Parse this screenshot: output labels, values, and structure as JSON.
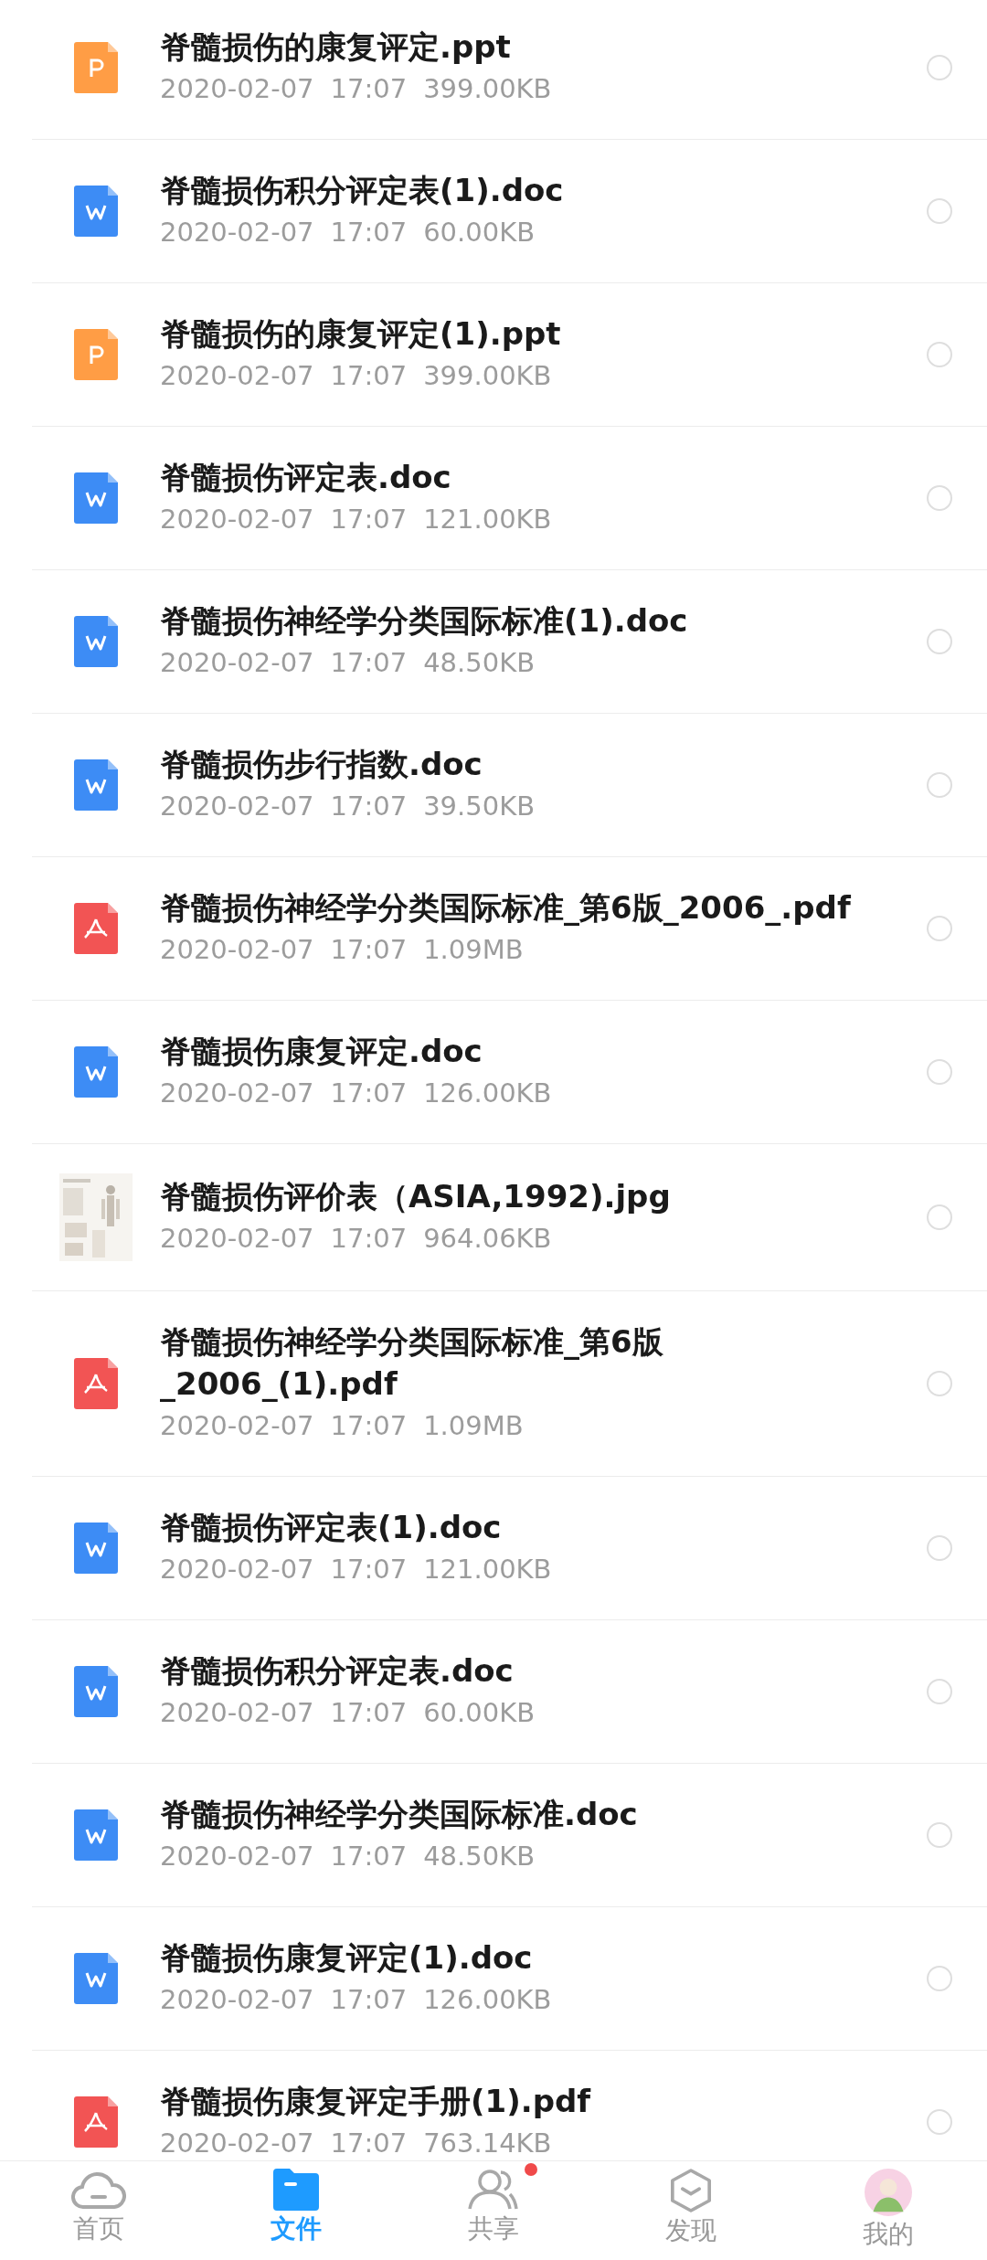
{
  "files": [
    {
      "kind": "ppt",
      "name": "脊髓损伤的康复评定.ppt",
      "date": "2020-02-07",
      "time": "17:07",
      "size": "399.00KB",
      "selected": false
    },
    {
      "kind": "doc",
      "name": "脊髓损伤积分评定表(1).doc",
      "date": "2020-02-07",
      "time": "17:07",
      "size": "60.00KB",
      "selected": false
    },
    {
      "kind": "ppt",
      "name": "脊髓损伤的康复评定(1).ppt",
      "date": "2020-02-07",
      "time": "17:07",
      "size": "399.00KB",
      "selected": false
    },
    {
      "kind": "doc",
      "name": "脊髓损伤评定表.doc",
      "date": "2020-02-07",
      "time": "17:07",
      "size": "121.00KB",
      "selected": false
    },
    {
      "kind": "doc",
      "name": "脊髓损伤神经学分类国际标准(1).doc",
      "date": "2020-02-07",
      "time": "17:07",
      "size": "48.50KB",
      "selected": false
    },
    {
      "kind": "doc",
      "name": "脊髓损伤步行指数.doc",
      "date": "2020-02-07",
      "time": "17:07",
      "size": "39.50KB",
      "selected": false
    },
    {
      "kind": "pdf",
      "name": "脊髓损伤神经学分类国际标准_第6版_2006_.pdf",
      "date": "2020-02-07",
      "time": "17:07",
      "size": "1.09MB",
      "selected": false
    },
    {
      "kind": "doc",
      "name": "脊髓损伤康复评定.doc",
      "date": "2020-02-07",
      "time": "17:07",
      "size": "126.00KB",
      "selected": false
    },
    {
      "name": "脊髓损伤评价表（ASIA,1992).jpg",
      "date": "2020-02-07",
      "time": "17:07",
      "size": "964.06KB",
      "selected": false
    },
    {
      "kind": "pdf",
      "name": "脊髓损伤神经学分类国际标准_第6版_2006_(1).pdf",
      "date": "2020-02-07",
      "time": "17:07",
      "size": "1.09MB",
      "selected": false
    },
    {
      "kind": "doc",
      "name": "脊髓损伤评定表(1).doc",
      "date": "2020-02-07",
      "time": "17:07",
      "size": "121.00KB",
      "selected": false
    },
    {
      "kind": "doc",
      "name": "脊髓损伤积分评定表.doc",
      "date": "2020-02-07",
      "time": "17:07",
      "size": "60.00KB",
      "selected": false
    },
    {
      "kind": "doc",
      "name": "脊髓损伤神经学分类国际标准.doc",
      "date": "2020-02-07",
      "time": "17:07",
      "size": "48.50KB",
      "selected": false
    },
    {
      "kind": "doc",
      "name": "脊髓损伤康复评定(1).doc",
      "date": "2020-02-07",
      "time": "17:07",
      "size": "126.00KB",
      "selected": false
    },
    {
      "kind": "pdf",
      "name": "脊髓损伤康复评定手册(1).pdf",
      "date": "2020-02-07",
      "time": "17:07",
      "size": "763.14KB",
      "selected": false
    }
  ],
  "tab_bar": [
    {
      "kind": "home",
      "label": "首页",
      "selected": false,
      "badge": false
    },
    {
      "kind": "files",
      "label": "文件",
      "selected": true,
      "badge": false
    },
    {
      "kind": "share",
      "label": "共享",
      "selected": false,
      "badge": true
    },
    {
      "kind": "discover",
      "label": "发现",
      "selected": false,
      "badge": false
    },
    {
      "kind": "profile",
      "label": "我的",
      "selected": false,
      "badge": false
    }
  ]
}
